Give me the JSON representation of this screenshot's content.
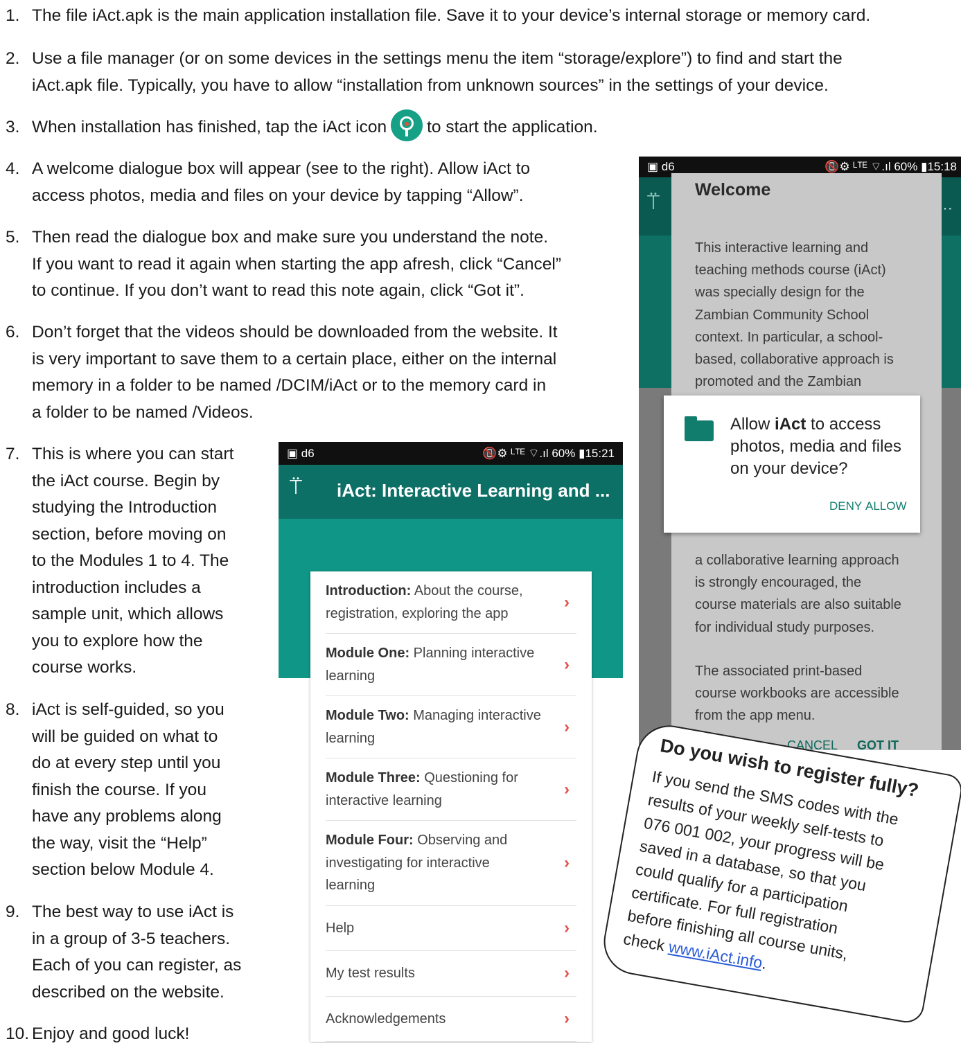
{
  "steps": [
    {
      "num": "1.",
      "text": "The file iAct.apk is the main application installation file. Save it to your device’s internal storage or memory card."
    },
    {
      "num": "2.",
      "text": "Use a file manager (or on some devices in the settings menu the item “storage/explore”) to find and start the\niAct.apk file. Typically, you have to allow “installation from unknown sources” in the settings of your device."
    },
    {
      "num": "3.",
      "text_before": "When installation has finished, tap the iAct icon",
      "text_after": "to start the application."
    },
    {
      "num": "4.",
      "text": "A welcome dialogue box will appear (see to the right). Allow iAct to\naccess photos, media and files on your device by tapping “Allow”."
    },
    {
      "num": "5.",
      "text": "Then read the dialogue box and make sure you understand the note.\nIf you want to read it again when starting the app afresh, click “Cancel”\nto continue. If you don’t want to read this note again, click “Got it”."
    },
    {
      "num": "6.",
      "text": "Don’t forget that the videos should be downloaded from the website. It\nis very important to save them to a certain place, either on the internal\nmemory in a folder to be named /DCIM/iAct or to the memory card in\na folder to be named /Videos."
    },
    {
      "num": "7.",
      "text": "This is where you can start\nthe iAct course. Begin by\nstudying the Introduction\nsection, before moving on\nto the Modules 1 to 4. The\nintroduction includes a\nsample unit, which allows\nyou to explore how the\ncourse works."
    },
    {
      "num": "8.",
      "text": "iAct is self-guided, so you\nwill be guided on what to\ndo at every step until you\nfinish the course. If you\nhave any problems along\n the way, visit the “Help”\nsection below Module 4."
    },
    {
      "num": "9.",
      "text": "The best way to use iAct is\nin a group of 3-5 teachers.\nEach of you can register, as\ndescribed on the website."
    },
    {
      "num": "10.",
      "text": "Enjoy and good luck!"
    }
  ],
  "welcome_screen": {
    "status_left": "▣ d6",
    "status_right": "📵⚙ ᴸᵀᴱ ⌔.ıl 60% ▮15:18",
    "title": "Welcome",
    "para1": "This interactive learning and\nteaching methods course (iAct)\nwas specially design for the\nZambian Community School\ncontext. In particular, a school-\nbased, collaborative approach is\npromoted and the Zambian\nprimary school curriculum is",
    "para2": "a collaborative learning approach\nis strongly encouraged, the\ncourse materials are also suitable\nfor individual study purposes.",
    "para3": "The associated print-based\ncourse workbooks are accessible\nfrom the app menu.",
    "cancel": "CANCEL",
    "got_it": "GOT IT",
    "permission": {
      "pre": "Allow ",
      "app": "iAct",
      "post": " to access photos, media and files on your device?",
      "deny": "DENY",
      "allow": "ALLOW"
    }
  },
  "menu_screen": {
    "status_left": "▣ d6",
    "status_right": "📵⚙ ᴸᵀᴱ ⌔.ıl 60% ▮15:21",
    "title": "iAct: Interactive Learning and ...",
    "items": [
      {
        "bold": "Introduction:",
        "text": " About the course, registration, exploring the app"
      },
      {
        "bold": "Module One:",
        "text": " Planning interactive learning"
      },
      {
        "bold": "Module Two:",
        "text": " Managing interactive learning"
      },
      {
        "bold": "Module Three:",
        "text": " Questioning for interactive learning"
      },
      {
        "bold": "Module Four:",
        "text": " Observing and investigating for interactive learning"
      },
      {
        "bold": "",
        "text": "Help"
      },
      {
        "bold": "",
        "text": "My test results"
      },
      {
        "bold": "",
        "text": "Acknowledgements"
      }
    ]
  },
  "note": {
    "heading": "Do you wish to register fully?",
    "body": "If you send the SMS codes with the\nresults of your weekly self-tests to\n076 001 002, your progress will be\nsaved in a database, so that you\ncould qualify for a participation\ncertificate. For full registration\nbefore finishing all course units,\ncheck ",
    "link": "www.iAct.info",
    "after": "."
  },
  "icons": [
    "iact-app-icon",
    "folder-icon",
    "chevron-right-icon"
  ],
  "colors": {
    "teal_dark": "#0d7066",
    "teal": "#0f9686",
    "chevron": "#e0514a"
  }
}
